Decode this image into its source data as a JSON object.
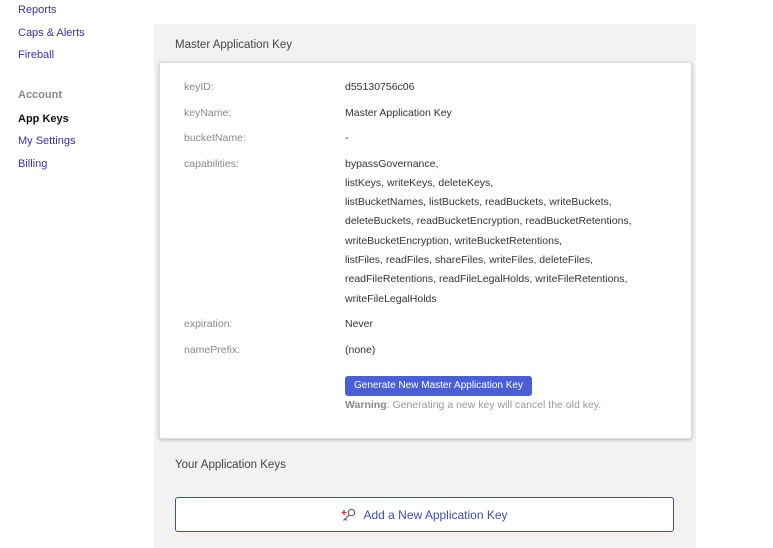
{
  "sidebar": {
    "items_top": [
      "Reports",
      "Caps & Alerts",
      "Fireball"
    ],
    "section_label": "Account",
    "items_account": [
      "App Keys",
      "My Settings",
      "Billing"
    ]
  },
  "master_key": {
    "title": "Master Application Key",
    "rows": {
      "keyID": {
        "label": "keyID:",
        "value": "d55130756c06"
      },
      "keyName": {
        "label": "keyName:",
        "value": "Master Application Key"
      },
      "bucketName": {
        "label": "bucketName:",
        "value": "-"
      },
      "capabilities": {
        "label": "capabilities:",
        "lines": [
          "bypassGovernance,",
          "listKeys, writeKeys, deleteKeys,",
          "listBucketNames, listBuckets, readBuckets, writeBuckets,",
          "deleteBuckets, readBucketEncryption, readBucketRetentions,",
          "writeBucketEncryption, writeBucketRetentions,",
          "listFiles, readFiles, shareFiles, writeFiles, deleteFiles,",
          "readFileRetentions, readFileLegalHolds, writeFileRetentions,",
          "writeFileLegalHolds"
        ]
      },
      "expiration": {
        "label": "expiration:",
        "value": "Never"
      },
      "namePrefix": {
        "label": "namePrefix:",
        "value": "(none)"
      }
    },
    "generate_button": "Generate New Master Application Key",
    "warning_bold": "Warning",
    "warning_text": ": Generating a new key will cancel the old key."
  },
  "app_keys": {
    "title": "Your Application Keys",
    "add_button": "Add a New Application Key",
    "add_icon": "key-plus-icon"
  },
  "colors": {
    "link": "#3b2fb1",
    "primary_button": "#4a5fd6",
    "outline_button": "#3b4fb5",
    "panel_bg": "#f2f2f2"
  }
}
